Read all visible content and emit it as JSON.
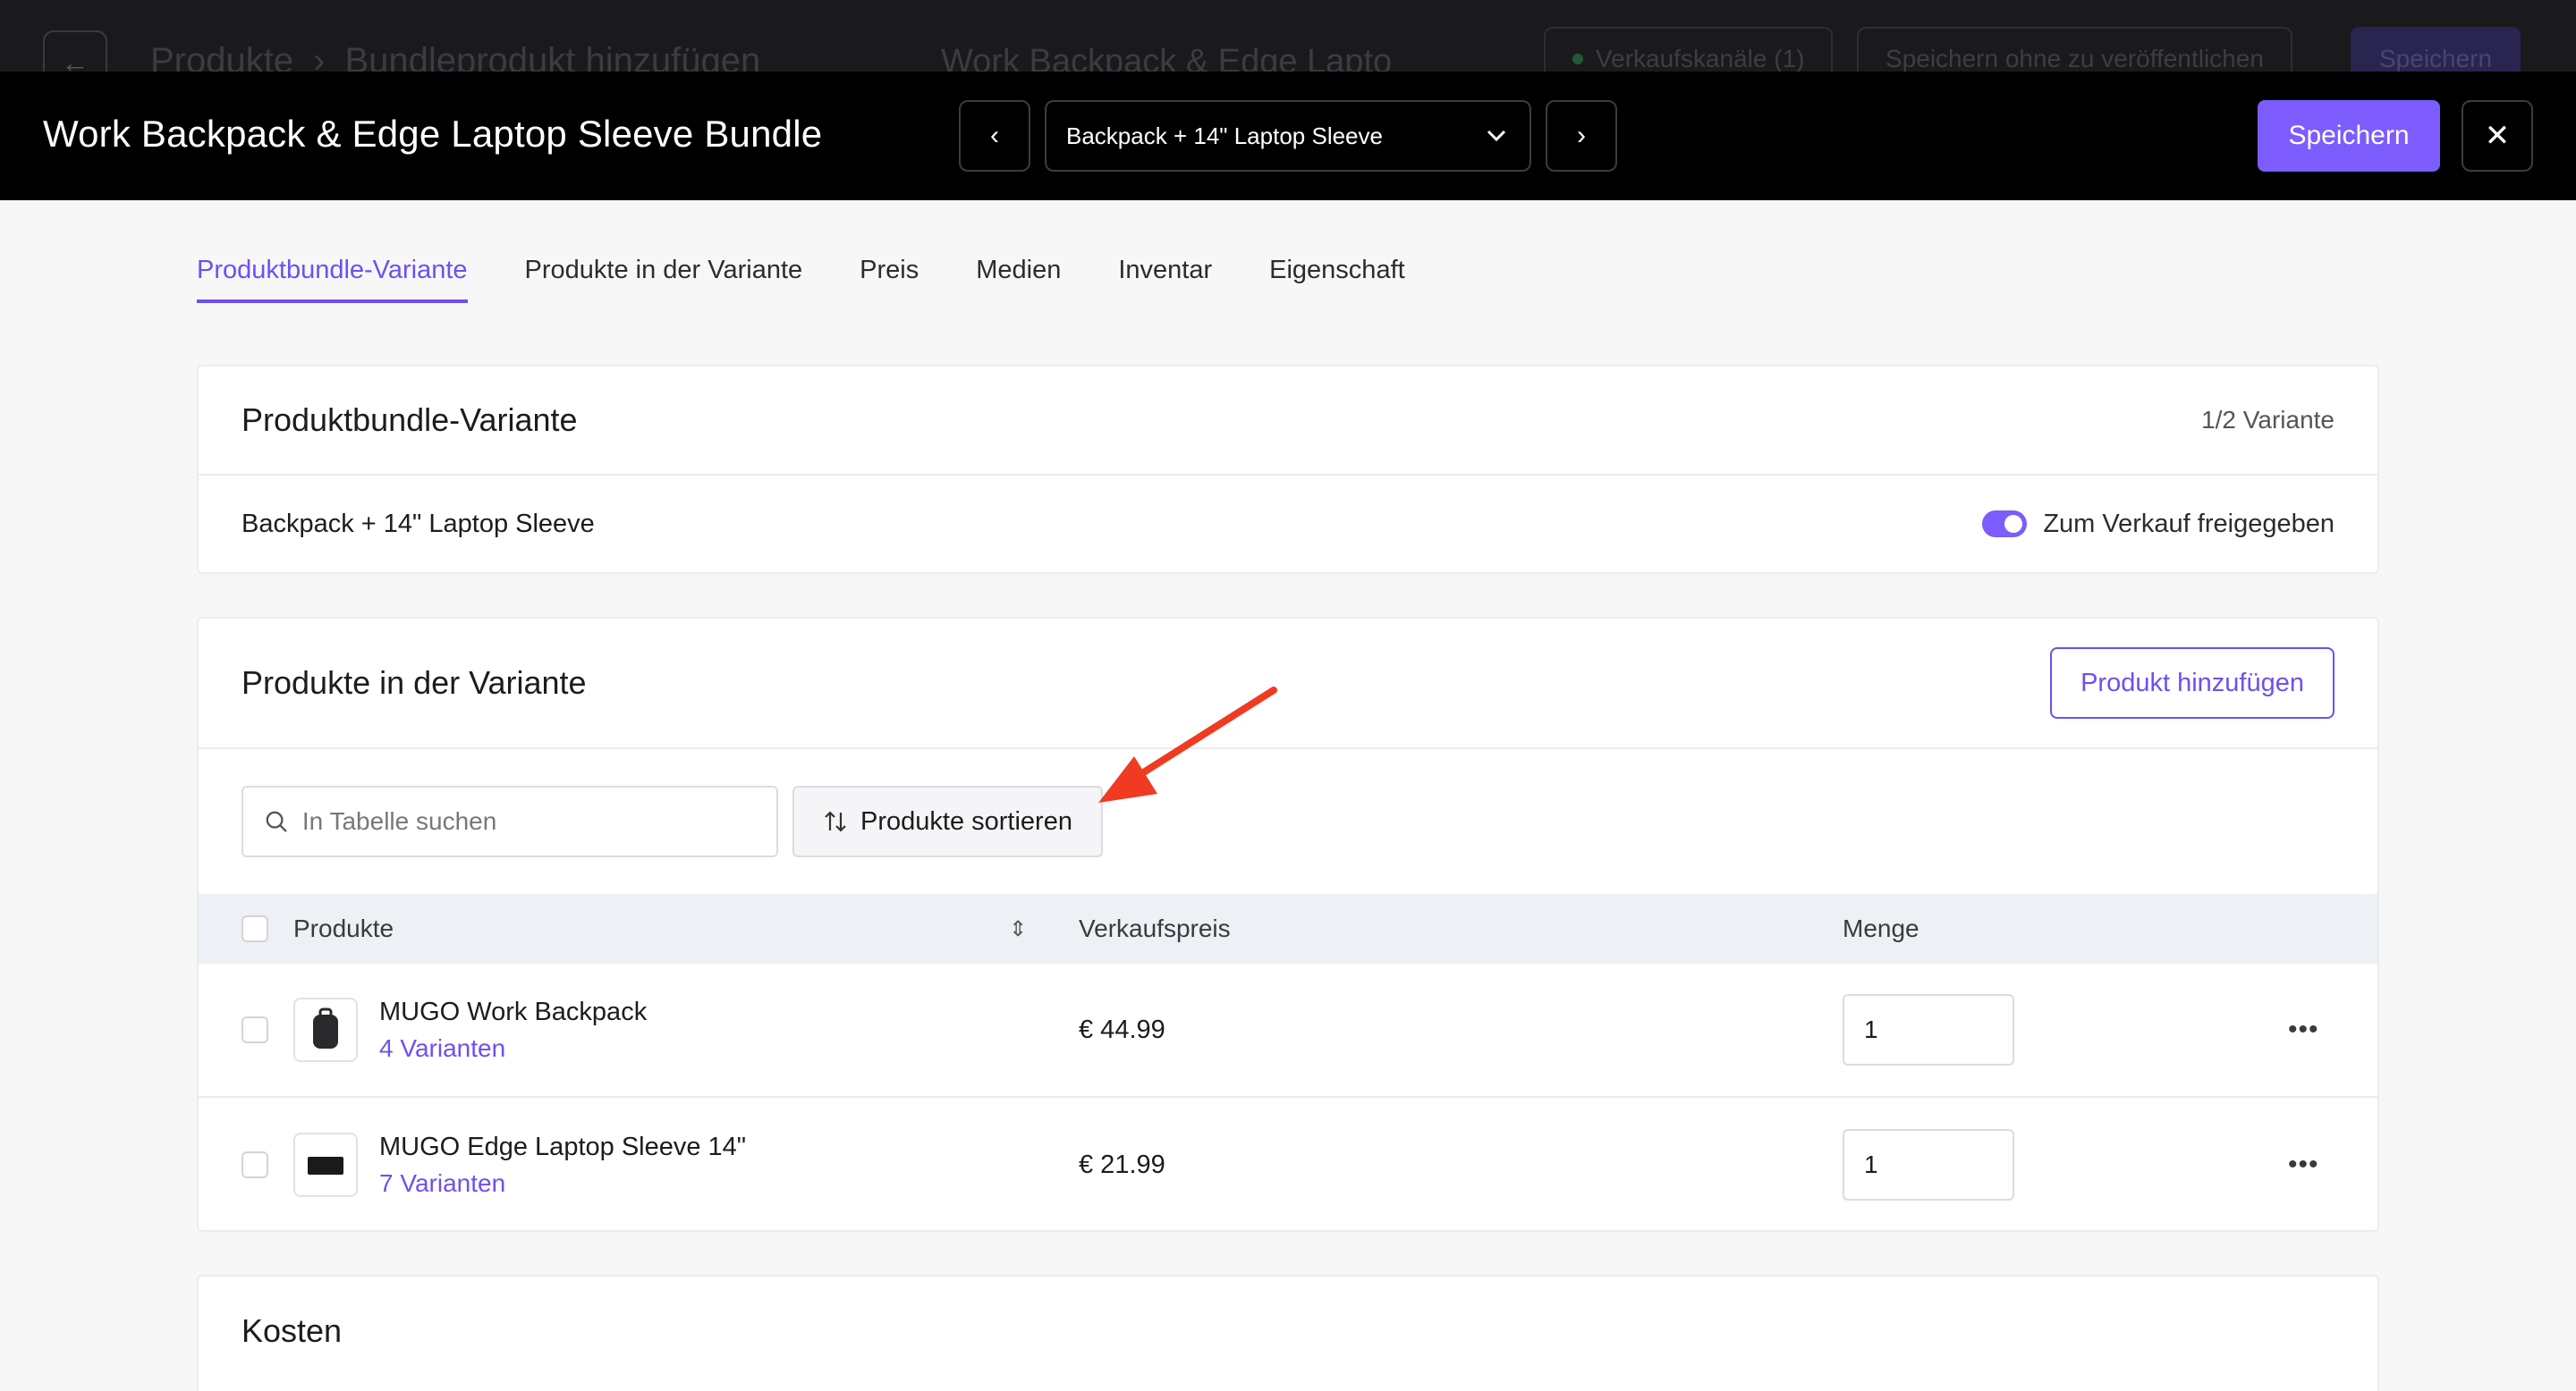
{
  "background": {
    "breadcrumb": [
      "Produkte",
      "Bundleprodukt hinzufügen"
    ],
    "breadcrumb_sep": "›",
    "product_title": "Work Backpack & Edge Lapto",
    "sales_channels": "Verkaufskanäle (1)",
    "save_without_publish": "Speichern ohne zu veröffentlichen",
    "save": "Speichern"
  },
  "modal": {
    "title": "Work Backpack & Edge Laptop Sleeve Bundle",
    "variant_selected": "Backpack + 14\" Laptop Sleeve",
    "save_label": "Speichern"
  },
  "tabs": [
    {
      "label": "Produktbundle-Variante",
      "active": true
    },
    {
      "label": "Produkte in der Variante"
    },
    {
      "label": "Preis"
    },
    {
      "label": "Medien"
    },
    {
      "label": "Inventar"
    },
    {
      "label": "Eigenschaft"
    }
  ],
  "variant_card": {
    "title": "Produktbundle-Variante",
    "count": "1/2 Variante",
    "name": "Backpack + 14\" Laptop Sleeve",
    "toggle_label": "Zum Verkauf freigegeben"
  },
  "products_card": {
    "title": "Produkte in der Variante",
    "add_button": "Produkt hinzufügen",
    "search_placeholder": "In Tabelle suchen",
    "sort_button": "Produkte sortieren",
    "columns": {
      "product": "Produkte",
      "price": "Verkaufspreis",
      "quantity": "Menge"
    },
    "rows": [
      {
        "name": "MUGO Work Backpack",
        "variants": "4 Varianten",
        "price": "€ 44.99",
        "qty": "1"
      },
      {
        "name": "MUGO Edge Laptop Sleeve 14\"",
        "variants": "7 Varianten",
        "price": "€ 21.99",
        "qty": "1"
      }
    ]
  },
  "costs_card": {
    "title": "Kosten"
  },
  "colors": {
    "accent": "#7c5cfc",
    "annotation_arrow": "#f03a22"
  }
}
